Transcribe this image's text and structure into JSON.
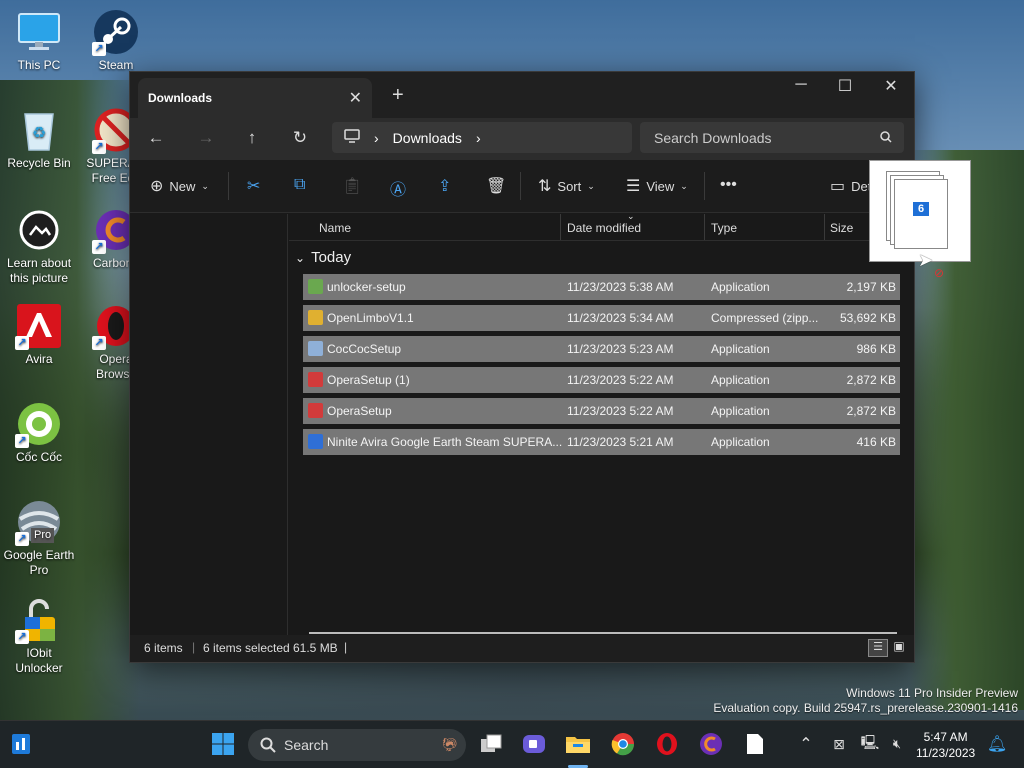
{
  "desktop": {
    "icons": [
      {
        "label": "This PC"
      },
      {
        "label": "Steam"
      },
      {
        "label": "Recycle Bin"
      },
      {
        "label": "SUPERAM Free Edit"
      },
      {
        "label": "Learn about this picture"
      },
      {
        "label": "Carbona"
      },
      {
        "label": "Avira"
      },
      {
        "label": "Opera Browse"
      },
      {
        "label": "Cốc Cốc"
      },
      {
        "label": "Google Earth Pro"
      },
      {
        "label": "IObit Unlocker"
      }
    ],
    "google_earth_badge": "Pro",
    "watermark_line1": "Windows 11 Pro Insider Preview",
    "watermark_line2": "Evaluation copy. Build 25947.rs_prerelease.230901-1416"
  },
  "window": {
    "tab_title": "Downloads",
    "tab_close": "✕",
    "new_tab": "+",
    "minimize": "─",
    "maximize": "☐",
    "close": "✕",
    "address_crumb": "Downloads",
    "search_placeholder": "Search Downloads",
    "toolbar": {
      "new_label": "New",
      "sort_label": "Sort",
      "view_label": "View",
      "details_label": "Det"
    },
    "columns": {
      "name": "Name",
      "date": "Date modified",
      "type": "Type",
      "size": "Size"
    },
    "group_label": "Today",
    "files": [
      {
        "name": "unlocker-setup",
        "date": "11/23/2023 5:38 AM",
        "type": "Application",
        "size": "2,197 KB",
        "icon_color": "#6aa84f"
      },
      {
        "name": "OpenLimboV1.1",
        "date": "11/23/2023 5:34 AM",
        "type": "Compressed (zipp...",
        "size": "53,692 KB",
        "icon_color": "#e0b030"
      },
      {
        "name": "CocCocSetup",
        "date": "11/23/2023 5:23 AM",
        "type": "Application",
        "size": "986 KB",
        "icon_color": "#8fb0d8"
      },
      {
        "name": "OperaSetup (1)",
        "date": "11/23/2023 5:22 AM",
        "type": "Application",
        "size": "2,872 KB",
        "icon_color": "#d23b3b"
      },
      {
        "name": "OperaSetup",
        "date": "11/23/2023 5:22 AM",
        "type": "Application",
        "size": "2,872 KB",
        "icon_color": "#d23b3b"
      },
      {
        "name": "Ninite Avira Google Earth Steam SUPERA...",
        "date": "11/23/2023 5:21 AM",
        "type": "Application",
        "size": "416 KB",
        "icon_color": "#2f6fd6"
      }
    ],
    "status": {
      "item_count": "6 items",
      "selected": "6 items selected",
      "selected_size": "61.5 MB"
    }
  },
  "drag_preview": {
    "count": "6"
  },
  "taskbar": {
    "search_label": "Search",
    "time": "5:47 AM",
    "date": "11/23/2023"
  }
}
